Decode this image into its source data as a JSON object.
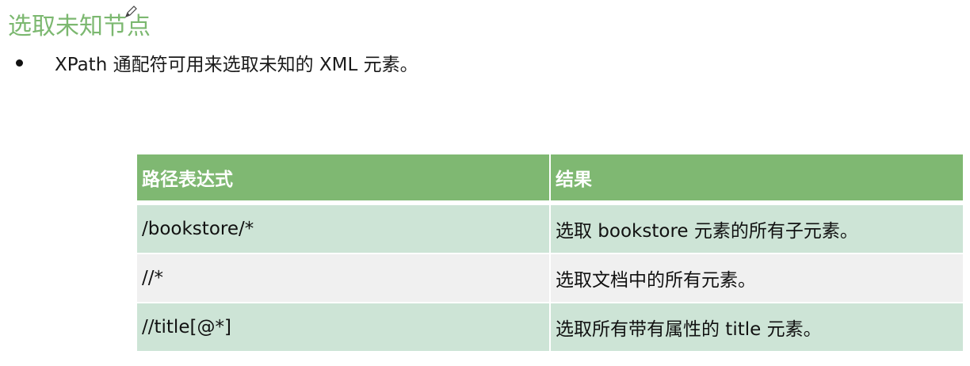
{
  "slide": {
    "title": "选取未知节点",
    "bullet": "XPath 通配符可用来选取未知的 XML 元素。"
  },
  "table": {
    "headers": [
      "路径表达式",
      "结果"
    ],
    "rows": [
      [
        "/bookstore/*",
        "选取 bookstore 元素的所有子元素。"
      ],
      [
        "//*",
        "选取文档中的所有元素。"
      ],
      [
        "//title[@*]",
        "选取所有带有属性的 title 元素。"
      ]
    ]
  },
  "colors": {
    "accent": "#7cb870",
    "header_bg": "#7fb872",
    "row_odd": "#cde4d6",
    "row_even": "#f0f0f0"
  },
  "icons": {
    "cursor": "pencil-icon"
  }
}
